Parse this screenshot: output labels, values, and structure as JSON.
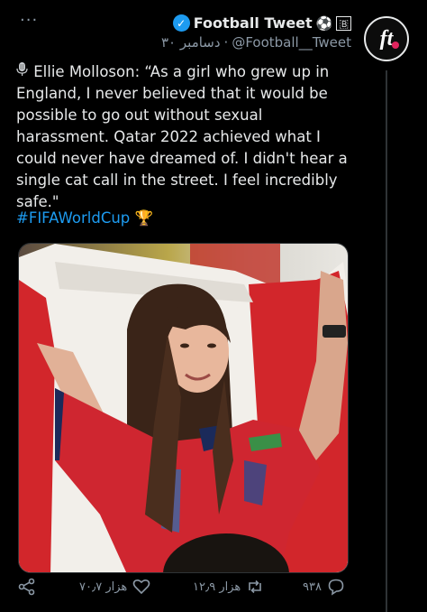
{
  "header": {
    "menu_label": "···",
    "display_name": "Football Tweet",
    "handle": "@Football__Tweet",
    "separator": "·",
    "date": "۳۰ دسامبر",
    "name_emoji": "⚽",
    "name_flag": "🇧"
  },
  "avatar": {
    "text": "ft"
  },
  "tweet": {
    "text": "Ellie Molloson: “As a girl who grew up in England, I never believed that it would be possible to go out without sexual harassment. Qatar 2022 achieved what I could never have dreamed of. I didn't hear a single cat call in the street. I feel incredibly safe.\"",
    "hashtag": "#FIFAWorldCup",
    "hashtag_emoji": "🏆"
  },
  "actions": {
    "replies": "۹۳۸",
    "retweets": "۱۲٫۹ هزار",
    "likes": "۷۰٫۷ هزار"
  },
  "colors": {
    "background": "#000000",
    "text": "#e7e9ea",
    "muted": "#8b98a5",
    "link": "#1d9bf0",
    "jersey_red": "#c8242c"
  }
}
